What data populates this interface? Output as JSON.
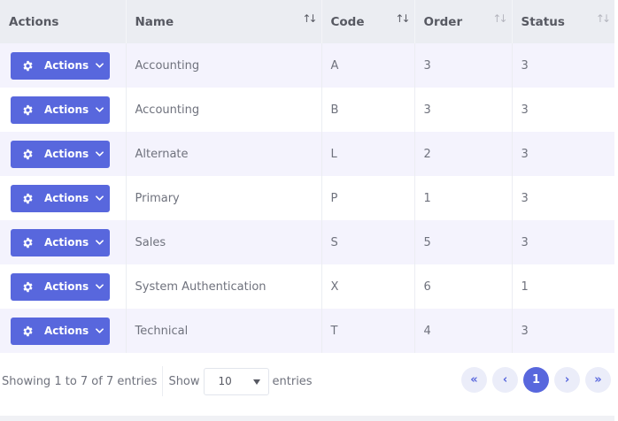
{
  "table": {
    "headers": [
      {
        "label": "Actions",
        "sort": ""
      },
      {
        "label": "Name",
        "sort": "↑↓"
      },
      {
        "label": "Code",
        "sort": "↑↓"
      },
      {
        "label": "Order",
        "sort": "↑↓"
      },
      {
        "label": "Status",
        "sort": "↑↓"
      }
    ],
    "action_label": "Actions",
    "rows": [
      {
        "name": "Accounting",
        "code": "A",
        "order": "3",
        "status": "3"
      },
      {
        "name": "Accounting",
        "code": "B",
        "order": "3",
        "status": "3"
      },
      {
        "name": "Alternate",
        "code": "L",
        "order": "2",
        "status": "3"
      },
      {
        "name": "Primary",
        "code": "P",
        "order": "1",
        "status": "3"
      },
      {
        "name": "Sales",
        "code": "S",
        "order": "5",
        "status": "3"
      },
      {
        "name": "System Authentication",
        "code": "X",
        "order": "6",
        "status": "1"
      },
      {
        "name": "Technical",
        "code": "T",
        "order": "4",
        "status": "3"
      }
    ]
  },
  "footer": {
    "info": "Showing 1 to 7 of 7 entries",
    "show_label": "Show",
    "page_size": "10",
    "entries_label": "entries",
    "pagination": {
      "first": "«",
      "prev": "‹",
      "current": "1",
      "next": "›",
      "last": "»"
    }
  },
  "colors": {
    "accent": "#5867dd",
    "header_bg": "#ebedf2",
    "stripe": "#f4f3fd"
  }
}
